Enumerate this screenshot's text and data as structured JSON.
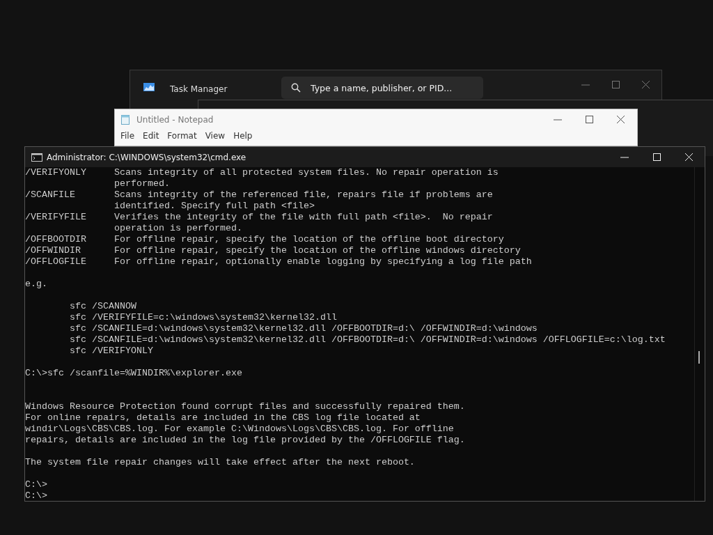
{
  "task_manager": {
    "title": "Task Manager",
    "search": {
      "placeholder": "Type a name, publisher, or PID..."
    }
  },
  "notepad": {
    "title": "Untitled - Notepad",
    "menu": [
      "File",
      "Edit",
      "Format",
      "View",
      "Help"
    ]
  },
  "cmd": {
    "title": "Administrator: C:\\WINDOWS\\system32\\cmd.exe",
    "output": "/VERIFYONLY     Scans integrity of all protected system files. No repair operation is\n                performed.\n/SCANFILE       Scans integrity of the referenced file, repairs file if problems are\n                identified. Specify full path <file>\n/VERIFYFILE     Verifies the integrity of the file with full path <file>.  No repair\n                operation is performed.\n/OFFBOOTDIR     For offline repair, specify the location of the offline boot directory\n/OFFWINDIR      For offline repair, specify the location of the offline windows directory\n/OFFLOGFILE     For offline repair, optionally enable logging by specifying a log file path\n\ne.g.\n\n        sfc /SCANNOW\n        sfc /VERIFYFILE=c:\\windows\\system32\\kernel32.dll\n        sfc /SCANFILE=d:\\windows\\system32\\kernel32.dll /OFFBOOTDIR=d:\\ /OFFWINDIR=d:\\windows\n        sfc /SCANFILE=d:\\windows\\system32\\kernel32.dll /OFFBOOTDIR=d:\\ /OFFWINDIR=d:\\windows /OFFLOGFILE=c:\\log.txt\n        sfc /VERIFYONLY\n\nC:\\>sfc /scanfile=%WINDIR%\\explorer.exe\n\n\nWindows Resource Protection found corrupt files and successfully repaired them.\nFor online repairs, details are included in the CBS log file located at\nwindir\\Logs\\CBS\\CBS.log. For example C:\\Windows\\Logs\\CBS\\CBS.log. For offline\nrepairs, details are included in the log file provided by the /OFFLOGFILE flag.\n\nThe system file repair changes will take effect after the next reboot.\n\nC:\\>\nC:\\>"
  }
}
